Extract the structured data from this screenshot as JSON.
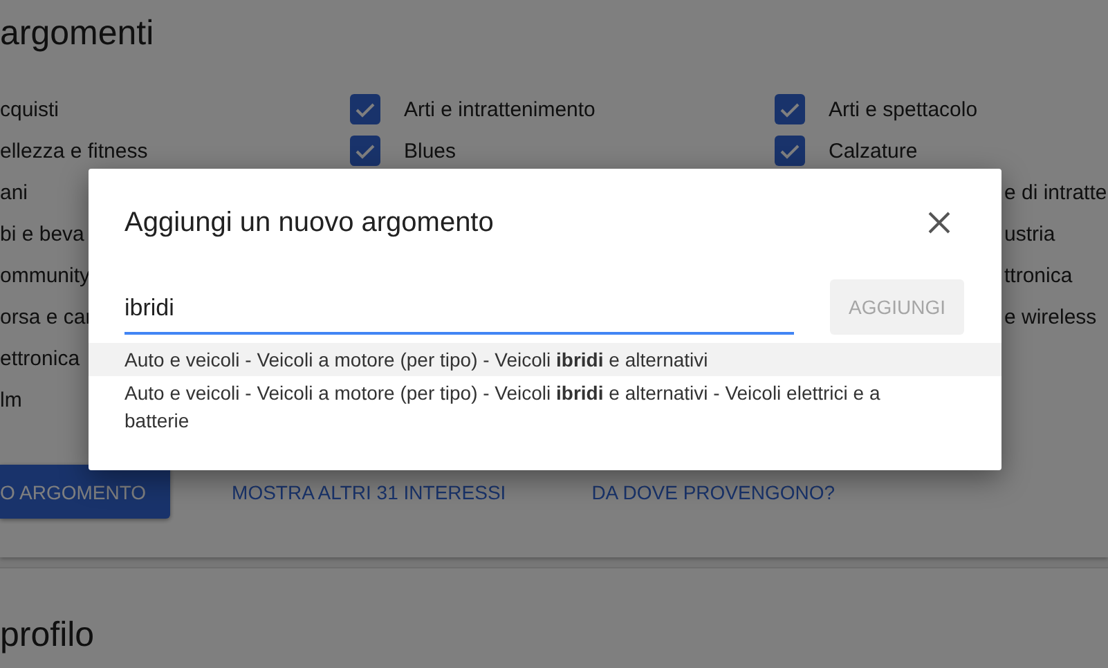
{
  "page": {
    "heading": "argomenti",
    "columns": [
      {
        "items": [
          {
            "kind": "fragment",
            "label": "cquisti"
          },
          {
            "kind": "fragment",
            "label": "ellezza e fitness"
          },
          {
            "kind": "fragment",
            "label": "ani"
          },
          {
            "kind": "fragment",
            "label": "bi e beva"
          },
          {
            "kind": "fragment",
            "label": "ommunity"
          },
          {
            "kind": "fragment",
            "label": "orsa e car"
          },
          {
            "kind": "fragment",
            "label": "ettronica"
          },
          {
            "kind": "fragment",
            "label": "lm"
          }
        ]
      },
      {
        "items": [
          {
            "kind": "checkbox",
            "label": "Arti e intrattenimento",
            "checked": true
          },
          {
            "kind": "checkbox",
            "label": "Blues",
            "checked": true
          }
        ]
      },
      {
        "items": [
          {
            "kind": "checkbox",
            "label": "Arti e spettacolo",
            "checked": true
          },
          {
            "kind": "checkbox",
            "label": "Calzature",
            "checked": true
          },
          {
            "kind": "fragment",
            "label": "e di intratte"
          },
          {
            "kind": "fragment",
            "label": "ustria"
          },
          {
            "kind": "fragment",
            "label": "ttronica"
          },
          {
            "kind": "fragment",
            "label": "e wireless"
          }
        ]
      }
    ],
    "add_button": "O ARGOMENTO",
    "links": [
      "MOSTRA ALTRI 31 INTERESSI",
      "DA DOVE PROVENGONO?"
    ],
    "next_section_heading": "profilo"
  },
  "dialog": {
    "title": "Aggiungi un nuovo argomento",
    "input": {
      "value": "ibridi"
    },
    "add_button": {
      "label": "AGGIUNGI",
      "disabled": true
    },
    "suggestions": [
      {
        "text": "Auto e veicoli - Veicoli a motore (per tipo) - Veicoli **ibridi** e alternativi",
        "selected": true
      },
      {
        "text": "Auto e veicoli - Veicoli a motore (per tipo) - Veicoli **ibridi** e alternativi - Veicoli elettrici e a batterie",
        "selected": false
      }
    ]
  }
}
